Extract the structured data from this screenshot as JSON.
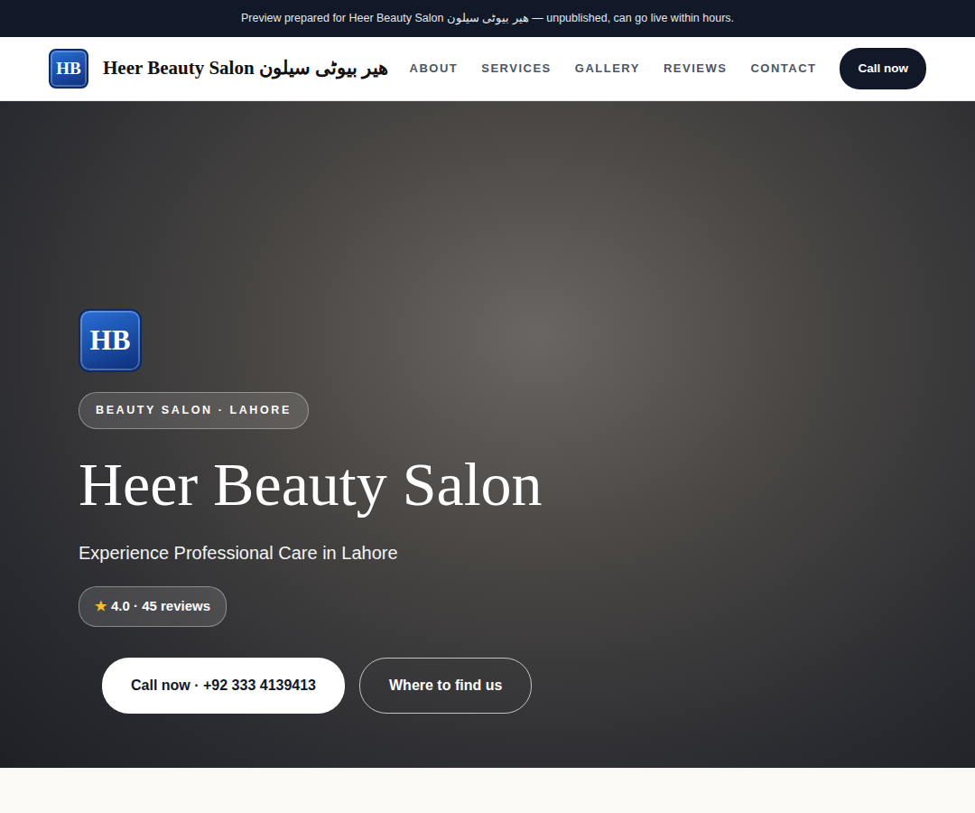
{
  "banner": "Preview prepared for Heer Beauty Salon هیر بیوٹی سیلون — unpublished, can go live within hours.",
  "brand": {
    "logo": "HB",
    "name": "Heer Beauty Salon هیر بیوٹی سیلون"
  },
  "nav": {
    "links": [
      "ABOUT",
      "SERVICES",
      "GALLERY",
      "REVIEWS",
      "CONTACT"
    ],
    "cta": "Call now"
  },
  "hero": {
    "logo": "HB",
    "eyebrow": "BEAUTY SALON · LAHORE",
    "title": "Heer Beauty Salon",
    "tagline": "Experience Professional Care in Lahore",
    "rating": {
      "star": "★",
      "text": "4.0 · 45 reviews"
    },
    "buttons": [
      "Call now · +92 333 4139413",
      "Where to find us"
    ]
  }
}
